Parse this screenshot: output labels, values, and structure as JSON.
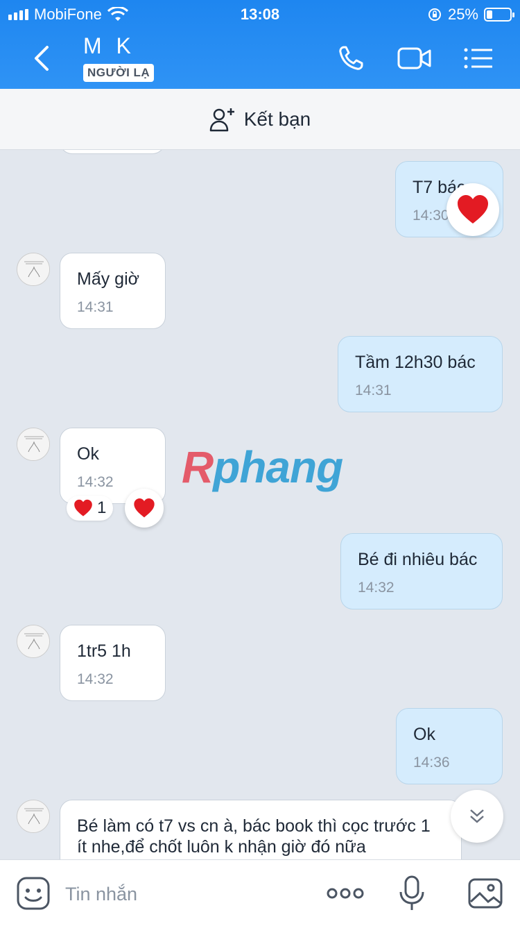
{
  "status": {
    "carrier": "MobiFone",
    "time": "13:08",
    "battery": "25%"
  },
  "header": {
    "name": "M K",
    "badge": "NGƯỜI LẠ"
  },
  "add_friend": {
    "label": "Kết bạn"
  },
  "messages": [
    {
      "dir": "out",
      "text": "T7 bác",
      "time": "14:30",
      "reaction": "heart"
    },
    {
      "dir": "in",
      "text": "Mấy giờ",
      "time": "14:31"
    },
    {
      "dir": "out",
      "text": "Tầm 12h30 bác",
      "time": "14:31"
    },
    {
      "dir": "in",
      "text": "Ok",
      "time": "14:32",
      "reaction_count": "1"
    },
    {
      "dir": "out",
      "text": "Bé đi nhiêu bác",
      "time": "14:32"
    },
    {
      "dir": "in",
      "text": "1tr5 1h",
      "time": "14:32"
    },
    {
      "dir": "out",
      "text": "Ok",
      "time": "14:36"
    },
    {
      "dir": "in",
      "text": "Bé làm có t7 vs cn à, bác book thì cọc trước 1 ít nhe,để chốt luôn k nhận giờ đó nữa",
      "time": ""
    }
  ],
  "watermark": {
    "r": "R",
    "rest": "phang"
  },
  "input": {
    "placeholder": "Tin nhắn"
  },
  "colors": {
    "header": "#1e86f0",
    "incoming": "#ffffff",
    "outgoing": "#d5ecfd",
    "chat_bg": "#e2e7ee"
  }
}
